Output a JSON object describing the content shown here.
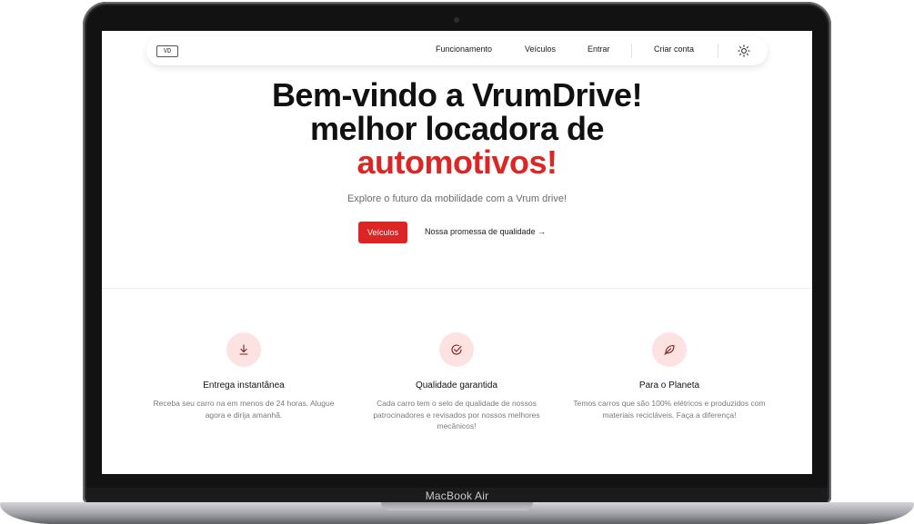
{
  "device": {
    "label": "MacBook Air"
  },
  "navbar": {
    "links": [
      "Funcionamento",
      "Veículos",
      "Entrar",
      "Criar conta"
    ],
    "logo_text": "VD",
    "theme_icon": "sun-icon"
  },
  "hero": {
    "title_line1": "Bem-vindo a VrumDrive!",
    "title_line2": "melhor locadora de",
    "title_accent": "automotivos!",
    "subtitle": "Explore o futuro da mobilidade com a Vrum drive!",
    "primary_button": "Veículos",
    "secondary_link": "Nossa promessa de qualidade →"
  },
  "features": [
    {
      "icon": "download-icon",
      "title": "Entrega instantânea",
      "description": "Receba seu carro na em menos de 24 horas. Alugue agora e dirija amanhã."
    },
    {
      "icon": "check-badge-icon",
      "title": "Qualidade garantida",
      "description": "Cada carro tem o selo de qualidade de nossos patrocinadores e revisados por nossos melhores mecânicos!"
    },
    {
      "icon": "leaf-icon",
      "title": "Para o Planeta",
      "description": "Temos carros que são 100% elétricos e produzidos com materiais recicláveis. Faça a diferença!"
    }
  ],
  "colors": {
    "accent": "#dc2626",
    "icon_bg": "#fde2e2"
  }
}
